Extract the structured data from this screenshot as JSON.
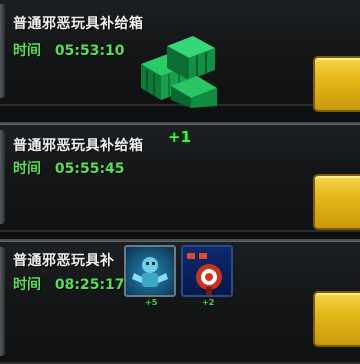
{
  "supply_list": [
    {
      "title": "普通邪恶玩具补给箱",
      "time_label": "时间",
      "time_value": "05:53:10",
      "icon": "green-crate-icon"
    },
    {
      "title": "普通邪恶玩具补给箱",
      "time_label": "时间",
      "time_value": "05:55:45",
      "plus_text": "+1"
    },
    {
      "title": "普通邪恶玩具补",
      "time_label": "时间",
      "time_value": "08:25:17",
      "items": [
        {
          "icon": "blue-toy-figure-icon",
          "count": "+5"
        },
        {
          "icon": "red-toy-target-icon",
          "count": "+2"
        }
      ]
    }
  ],
  "colors": {
    "title_text": "#f0f0f0",
    "timer_text": "#55e055",
    "button_gold": "#e4b719",
    "crate_green": "#1a9a4a"
  }
}
